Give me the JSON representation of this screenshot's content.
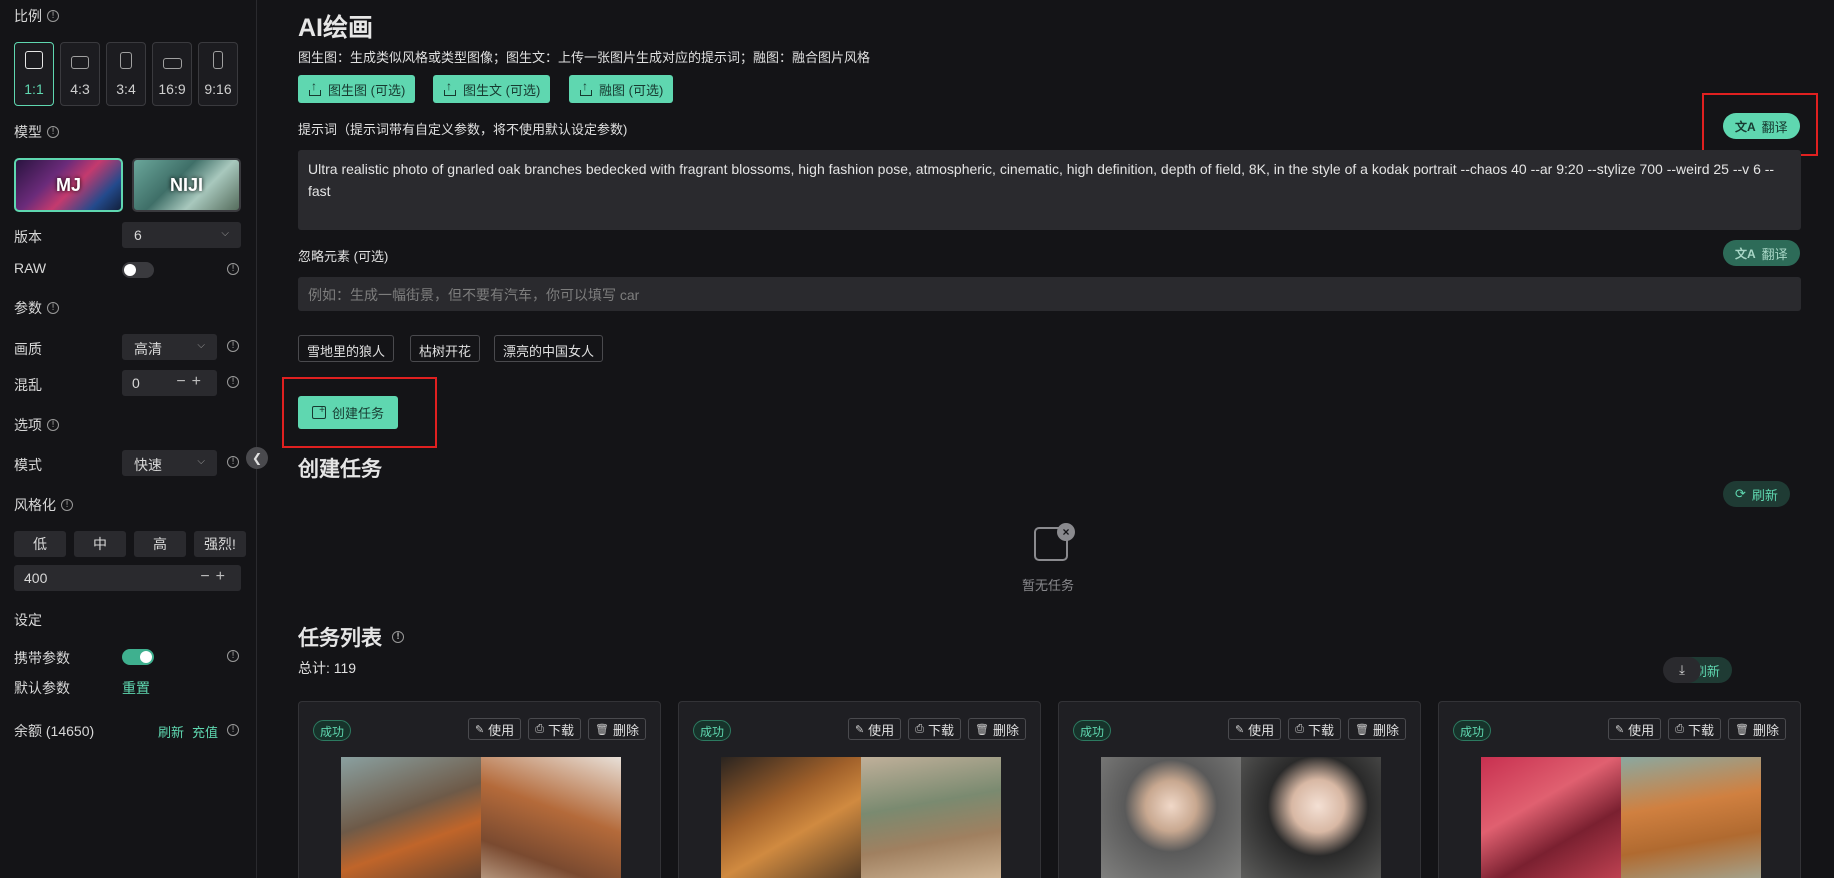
{
  "sidebar": {
    "ratio_label": "比例",
    "ratios": [
      {
        "label": "1:1",
        "active": true
      },
      {
        "label": "4:3",
        "active": false
      },
      {
        "label": "3:4",
        "active": false
      },
      {
        "label": "16:9",
        "active": false
      },
      {
        "label": "9:16",
        "active": false
      }
    ],
    "model_label": "模型",
    "models": [
      {
        "label": "MJ",
        "active": true
      },
      {
        "label": "NIJI",
        "active": false
      }
    ],
    "version_label": "版本",
    "version_value": "6",
    "raw_label": "RAW",
    "raw_on": false,
    "params_label": "参数",
    "quality_label": "画质",
    "quality_value": "高清",
    "chaos_label": "混乱",
    "chaos_value": "0",
    "options_label": "选项",
    "mode_label": "模式",
    "mode_value": "快速",
    "stylize_label": "风格化",
    "stylize_buttons": [
      "低",
      "中",
      "高",
      "强烈!"
    ],
    "stylize_value": "400",
    "settings_label": "设定",
    "carry_params_label": "携带参数",
    "carry_params_on": true,
    "default_params_label": "默认参数",
    "reset_label": "重置",
    "balance_label": "余额 (14650)",
    "refresh_label": "刷新",
    "recharge_label": "充值"
  },
  "main": {
    "title": "AI绘画",
    "description": "图生图：生成类似风格或类型图像；图生文：上传一张图片生成对应的提示词；融图：融合图片风格",
    "upload_buttons": [
      "图生图 (可选)",
      "图生文 (可选)",
      "融图 (可选)"
    ],
    "prompt_label": "提示词（提示词带有自定义参数，将不使用默认设定参数)",
    "translate_label": "翻译",
    "prompt_text": "Ultra realistic photo of gnarled oak branches bedecked with fragrant blossoms, high fashion pose, atmospheric, cinematic, high definition, depth of field, 8K, in the style of a kodak portrait --chaos 40 --ar 9:20 --stylize 700 --weird 25 --v 6 --fast",
    "negative_label": "忽略元素 (可选)",
    "negative_placeholder": "例如：生成一幅街景，但不要有汽车，你可以填写 car",
    "tags": [
      "雪地里的狼人",
      "枯树开花",
      "漂亮的中国女人"
    ],
    "create_button": "创建任务",
    "create_section_title": "创建任务",
    "refresh_label": "刷新",
    "empty_text": "暂无任务",
    "task_list_title": "任务列表",
    "total_label": "总计: 119",
    "cards": [
      {
        "status": "成功",
        "use": "使用",
        "download": "下载",
        "delete": "删除"
      },
      {
        "status": "成功",
        "use": "使用",
        "download": "下载",
        "delete": "删除"
      },
      {
        "status": "成功",
        "use": "使用",
        "download": "下载",
        "delete": "删除"
      },
      {
        "status": "成功",
        "use": "使用",
        "download": "下载",
        "delete": "删除"
      }
    ]
  },
  "colors": {
    "accent": "#5fd7b0",
    "background": "#141417",
    "highlight_box": "#e02020"
  },
  "icons": [
    "info-icon",
    "upload-icon",
    "translate-icon",
    "add-task-icon",
    "refresh-icon",
    "empty-inbox-icon",
    "download-icon",
    "use-icon",
    "delete-icon",
    "chevron-left-icon",
    "chevron-down-icon"
  ]
}
